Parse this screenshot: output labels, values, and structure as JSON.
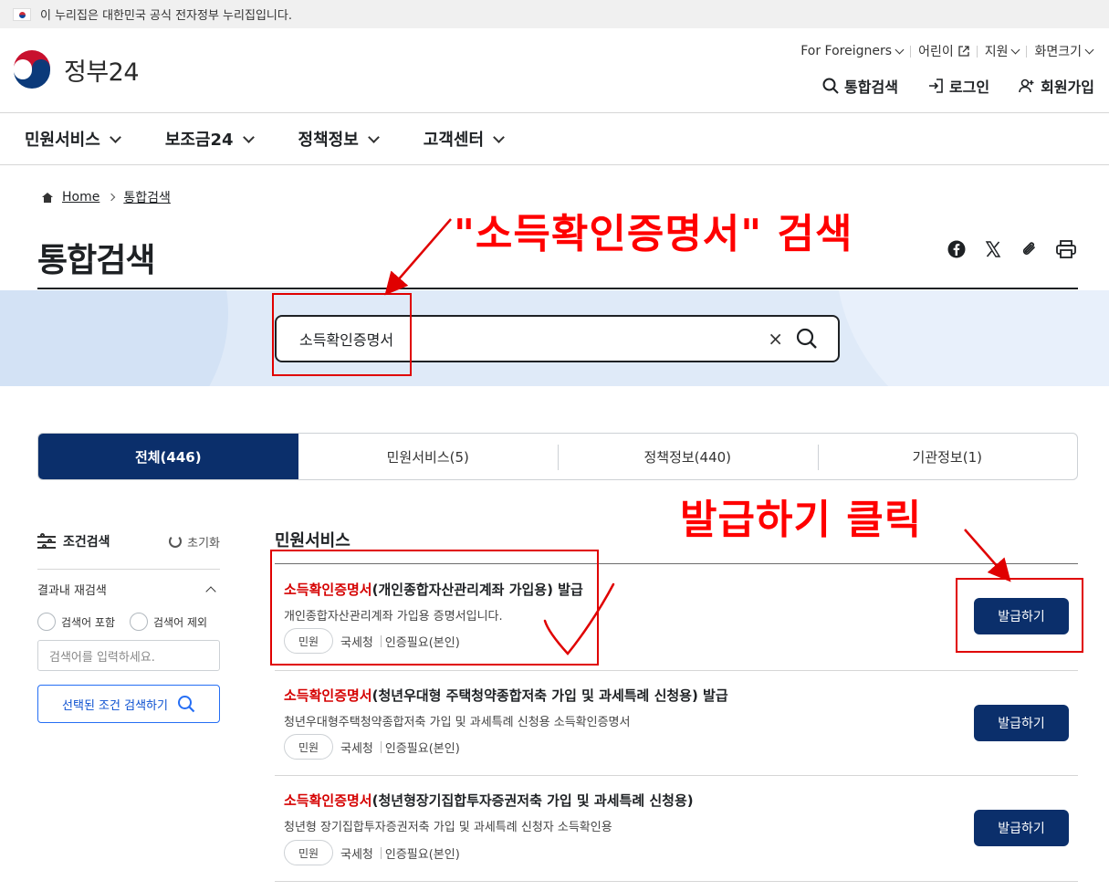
{
  "gov_banner": {
    "text": "이 누리집은 대한민국 공식 전자정부 누리집입니다."
  },
  "logo": {
    "text": "정부24"
  },
  "utility": {
    "foreigners": "For Foreigners",
    "kids": "어린이",
    "support": "지원",
    "font_size": "화면크기"
  },
  "main_links": {
    "search": "통합검색",
    "login": "로그인",
    "signup": "회원가입"
  },
  "gnb": [
    "민원서비스",
    "보조금24",
    "정책정보",
    "고객센터"
  ],
  "breadcrumb": {
    "home": "Home",
    "current": "통합검색"
  },
  "page_title": "통합검색",
  "search": {
    "value": "소득확인증명서"
  },
  "tabs": [
    {
      "label": "전체(446)",
      "active": true
    },
    {
      "label": "민원서비스(5)",
      "active": false
    },
    {
      "label": "정책정보(440)",
      "active": false
    },
    {
      "label": "기관정보(1)",
      "active": false
    }
  ],
  "side": {
    "title": "조건검색",
    "reset": "초기화",
    "subsection": "결과내 재검색",
    "include": "검색어 포함",
    "exclude": "검색어 제외",
    "input_placeholder": "검색어를 입력하세요.",
    "search_button": "선택된 조건 검색하기"
  },
  "section_title": "민원서비스",
  "results": [
    {
      "highlight": "소득확인증명서",
      "title_rest": "(개인종합자산관리계좌 가입용) 발급",
      "desc": "개인종합자산관리계좌 가입용 증명서입니다.",
      "badge": "민원",
      "agency": "국세청",
      "auth": "인증필요(본인)",
      "button": "발급하기"
    },
    {
      "highlight": "소득확인증명서",
      "title_rest": "(청년우대형 주택청약종합저축 가입 및 과세특례 신청용) 발급",
      "desc": "청년우대형주택청약종합저축 가입 및 과세특례 신청용 소득확인증명서",
      "badge": "민원",
      "agency": "국세청",
      "auth": "인증필요(본인)",
      "button": "발급하기"
    },
    {
      "highlight": "소득확인증명서",
      "title_rest": "(청년형장기집합투자증권저축 가입 및 과세특례 신청용)",
      "desc": "청년형 장기집합투자증권저축 가입 및 과세특례 신청자 소득확인용",
      "badge": "민원",
      "agency": "국세청",
      "auth": "인증필요(본인)",
      "button": "발급하기"
    }
  ],
  "annotations": {
    "search_note": "\"소득확인증명서\" 검색",
    "click_note": "발급하기 클릭",
    "color": "#ff0000"
  }
}
